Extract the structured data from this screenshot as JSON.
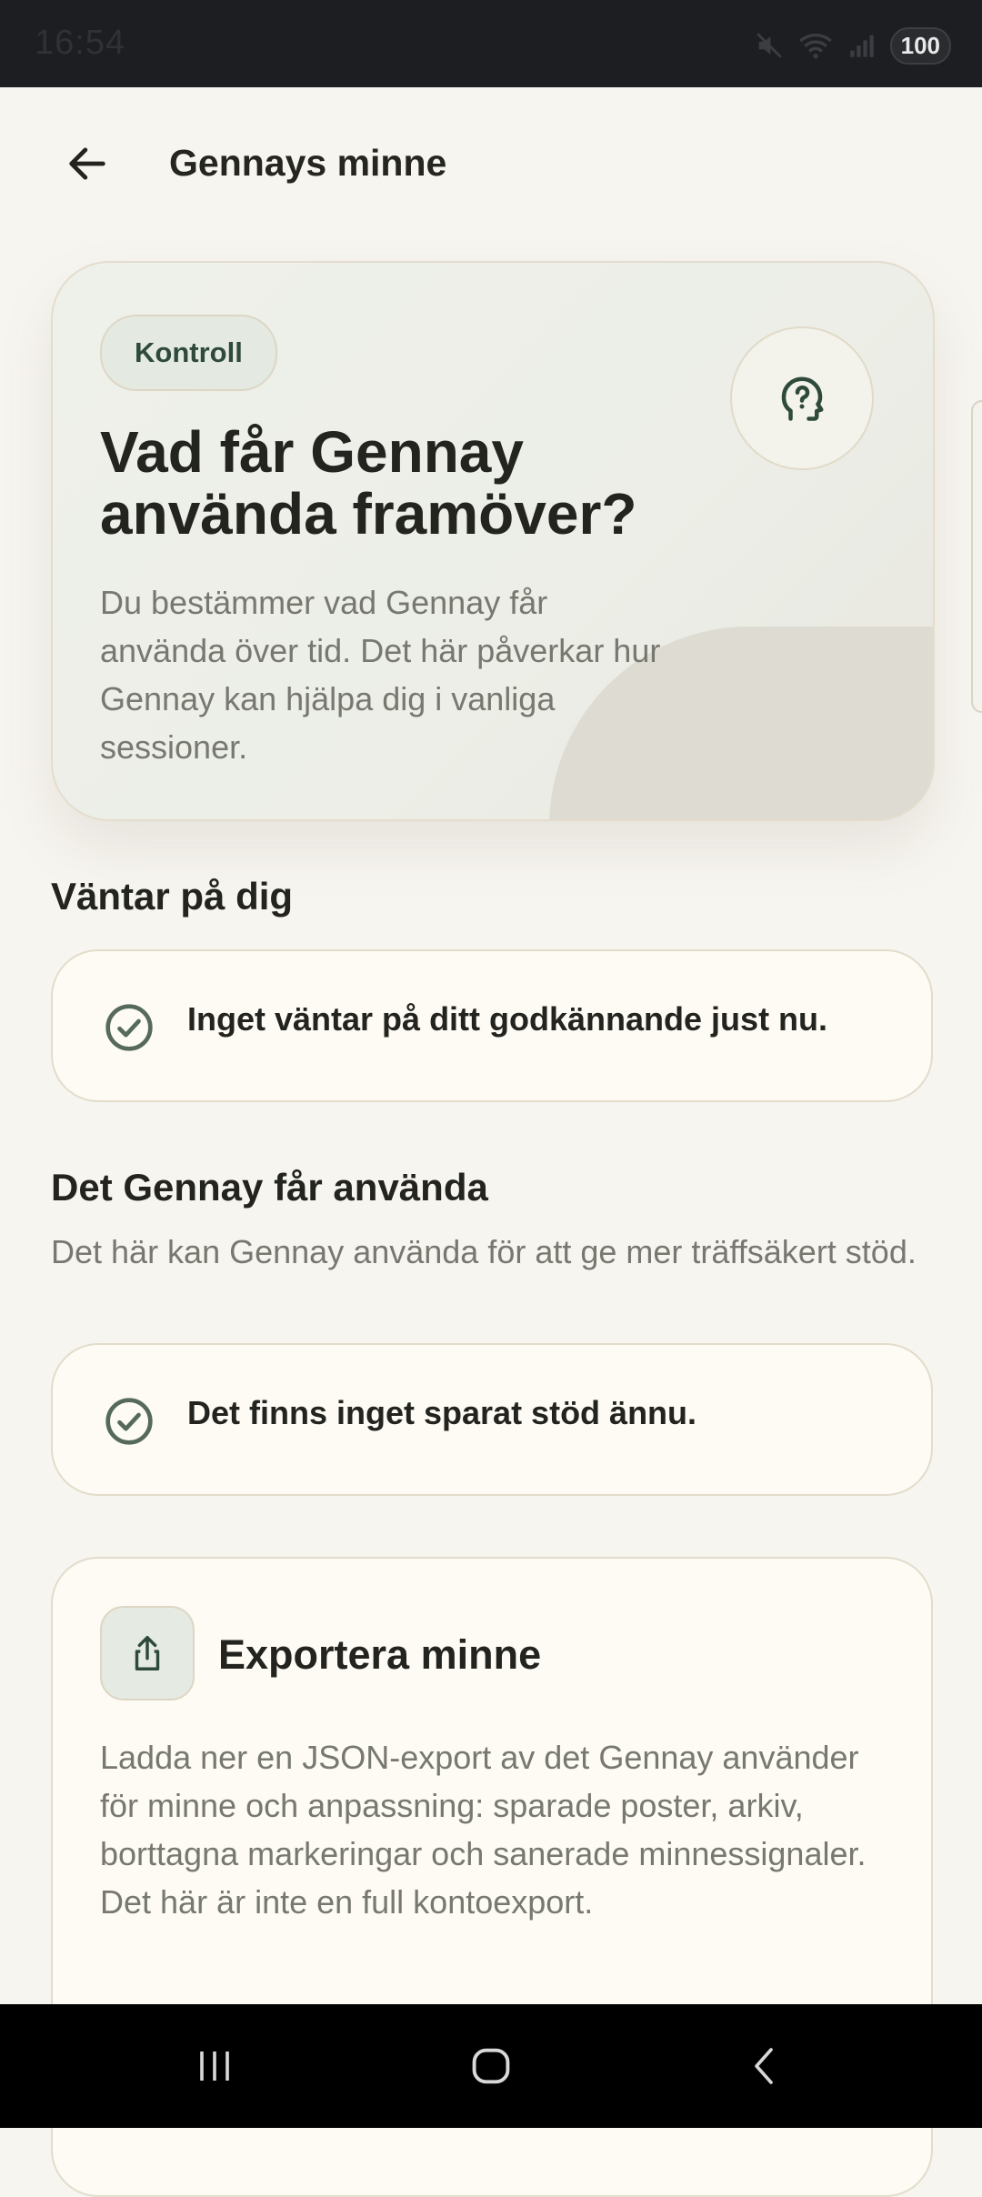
{
  "status_bar": {
    "time": "16:54",
    "battery": "100",
    "icons": [
      "mute-icon",
      "wifi-icon",
      "signal-icon",
      "battery-icon"
    ]
  },
  "header": {
    "title": "Gennays minne",
    "back_icon": "arrow-left-icon"
  },
  "hero": {
    "chip": "Kontroll",
    "title": "Vad får Gennay använda framöver?",
    "description": "Du bestämmer vad Gennay får använda över tid. Det här påverkar hur Gennay kan hjälpa dig i vanliga sessioner.",
    "icon": "head-question-icon"
  },
  "pending": {
    "title": "Väntar på dig",
    "card_text": "Inget väntar på ditt godkännande just nu.",
    "icon": "check-circle-icon"
  },
  "allowed": {
    "title": "Det Gennay får använda",
    "subtitle": "Det här kan Gennay använda för att ge mer träffsäkert stöd.",
    "card_text": "Det finns inget sparat stöd ännu.",
    "icon": "check-circle-icon"
  },
  "export": {
    "title": "Exportera minne",
    "description": "Ladda ner en JSON-export av det Gennay använder för minne och anpassning: sparade poster, arkiv, borttagna markeringar och sanerade minnessignaler. Det här är inte en full kontoexport.",
    "icon": "share-export-icon"
  },
  "navbar": {
    "items": [
      "recents-icon",
      "home-icon",
      "back-icon"
    ]
  },
  "colors": {
    "background": "#f7f5f0",
    "accent_green": "#2f4a3a",
    "card": "#fdfbf4",
    "muted_text": "#77786f"
  }
}
